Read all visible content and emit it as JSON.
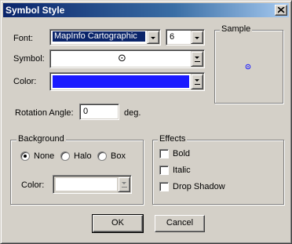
{
  "window": {
    "title": "Symbol Style"
  },
  "labels": {
    "font": "Font:",
    "symbol": "Symbol:",
    "color": "Color:",
    "rotation": "Rotation Angle:",
    "deg": "deg."
  },
  "font": {
    "name": "MapInfo Cartographic",
    "size": "6"
  },
  "symbol": {
    "glyph": "⊙"
  },
  "color": {
    "value": "#1a1aff"
  },
  "rotation": {
    "value": "0"
  },
  "sample": {
    "title": "Sample",
    "symbol_color": "#1a1aff"
  },
  "background": {
    "title": "Background",
    "options": [
      "None",
      "Halo",
      "Box"
    ],
    "selected": "None",
    "color_label": "Color:"
  },
  "effects": {
    "title": "Effects",
    "options": [
      {
        "label": "Bold",
        "checked": false
      },
      {
        "label": "Italic",
        "checked": false
      },
      {
        "label": "Drop Shadow",
        "checked": false
      }
    ]
  },
  "buttons": {
    "ok": "OK",
    "cancel": "Cancel"
  }
}
